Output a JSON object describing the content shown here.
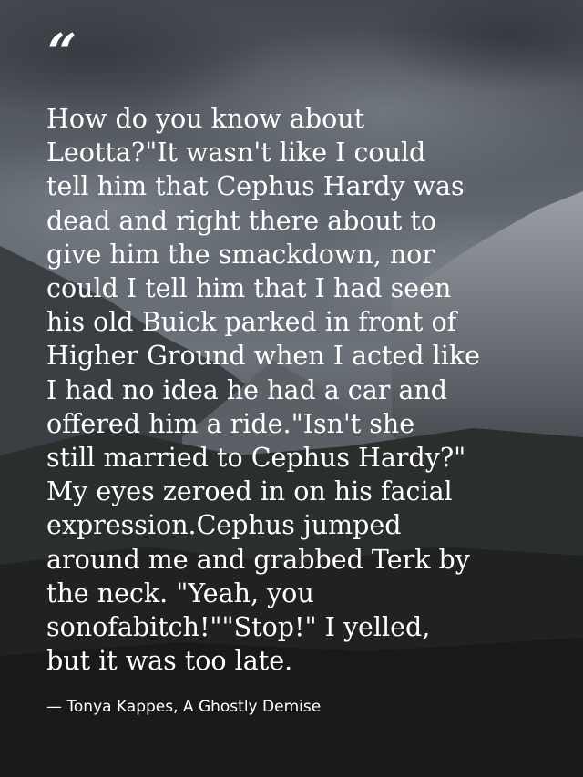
{
  "quote_mark": "“",
  "quote_text": "How do you know about\nLeotta?\"It wasn't like I could\ntell him that Cephus Hardy was\ndead and right there about to\ngive him the smackdown, nor\ncould I tell him that I had seen\nhis old Buick parked in front of\nHigher Ground when I acted like\nI had no idea he had a car and\noffered him a ride.\"Isn't she\nstill married to Cephus Hardy?\"\nMy eyes zeroed in on his facial\nexpression.Cephus jumped\naround me and grabbed Terk by\nthe neck. \"Yeah, you\nsonofabitch!\"\"Stop!\" I yelled,\nbut it was too late.",
  "attribution": "— Tonya Kappes, A Ghostly Demise",
  "colors": {
    "text": "#ffffff",
    "sky_top": "#4a4f55",
    "sky_mid": "#6b7178",
    "mountain": "#2c3035",
    "forest": "#1c1f1c"
  }
}
